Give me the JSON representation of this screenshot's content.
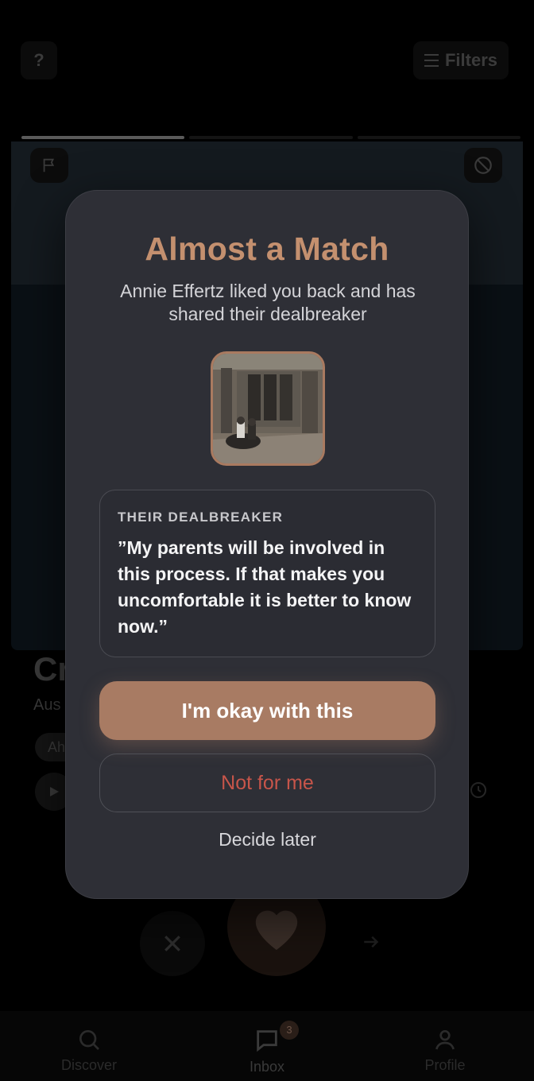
{
  "header": {
    "help_label": "?",
    "filters_label": "Filters"
  },
  "profile_card": {
    "name_partial": "Cr",
    "location_partial": "Aus",
    "chip_partial": "Ah"
  },
  "tabbar": {
    "discover": "Discover",
    "inbox": "Inbox",
    "inbox_badge": "3",
    "profile": "Profile"
  },
  "modal": {
    "title": "Almost a Match",
    "subtitle": "Annie Effertz liked you back and has shared their dealbreaker",
    "dealbreaker_label": "THEIR DEALBREAKER",
    "dealbreaker_text": "”My parents will be involved in this process. If that makes you uncomfortable it is better to know now.”",
    "accept_label": "I'm okay with this",
    "decline_label": "Not for me",
    "later_label": "Decide later"
  },
  "colors": {
    "accent": "#a87b63",
    "title": "#c4906f",
    "decline": "#c7554a",
    "modal_bg": "#2e2f36"
  }
}
